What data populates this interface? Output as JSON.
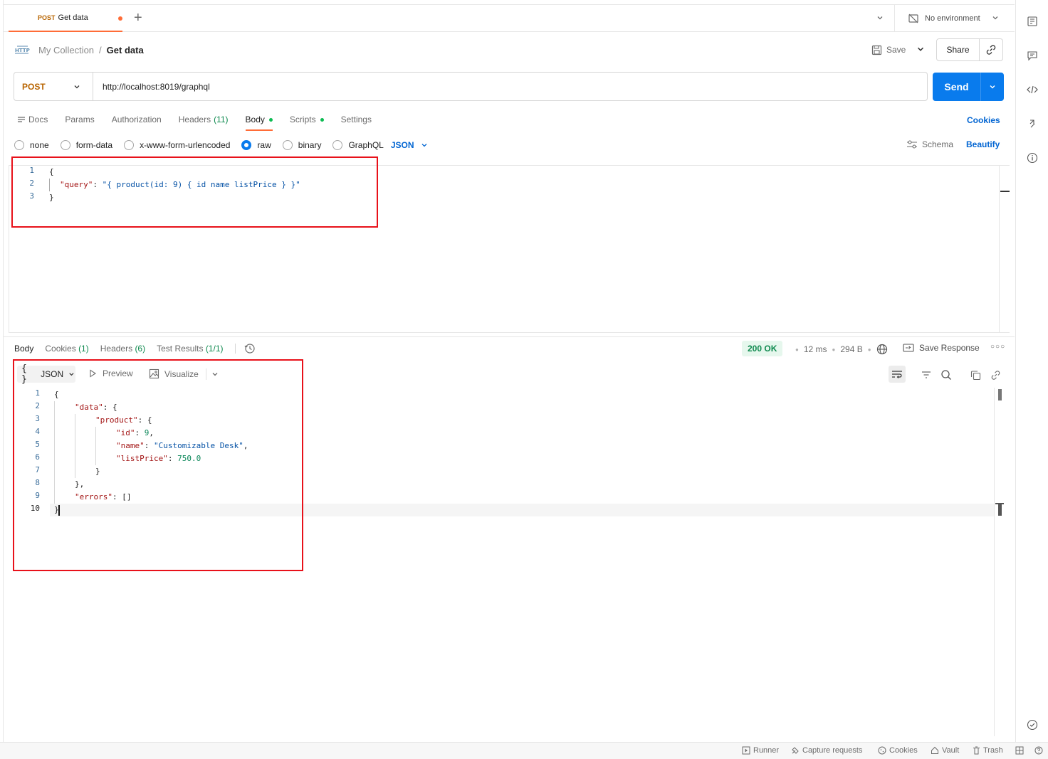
{
  "tabs": [
    {
      "method": "POST",
      "name": "Get data",
      "unsaved": true
    }
  ],
  "environment": {
    "label": "No environment"
  },
  "breadcrumb": {
    "collection": "My Collection",
    "separator": "/",
    "request": "Get data"
  },
  "header_actions": {
    "save": "Save",
    "share": "Share"
  },
  "request": {
    "method": "POST",
    "url": "http://localhost:8019/graphql",
    "send_label": "Send"
  },
  "request_tabs": {
    "docs": "Docs",
    "params": "Params",
    "authorization": "Authorization",
    "headers": "Headers",
    "headers_count": "(11)",
    "body": "Body",
    "scripts": "Scripts",
    "settings": "Settings",
    "cookies": "Cookies"
  },
  "body_types": {
    "none": "none",
    "form_data": "form-data",
    "urlencoded": "x-www-form-urlencoded",
    "raw": "raw",
    "binary": "binary",
    "graphql": "GraphQL",
    "format": "JSON",
    "schema": "Schema",
    "beautify": "Beautify"
  },
  "request_body": {
    "line_numbers": [
      "1",
      "2",
      "3"
    ],
    "open": "{",
    "key": "\"query\"",
    "colon": ": ",
    "value": "\"{ product(id: 9) { id name listPrice } }\"",
    "close": "}"
  },
  "response_tabs": {
    "body": "Body",
    "cookies": "Cookies",
    "cookies_count": "(1)",
    "headers": "Headers",
    "headers_count": "(6)",
    "tests": "Test Results",
    "tests_count": "(1/1)"
  },
  "response_meta": {
    "status": "200 OK",
    "time": "12 ms",
    "size": "294 B",
    "save_response": "Save Response"
  },
  "response_toolbar": {
    "format_braces": "{ }",
    "format": "JSON",
    "preview": "Preview",
    "visualize": "Visualize"
  },
  "response_body": {
    "line_numbers": [
      "1",
      "2",
      "3",
      "4",
      "5",
      "6",
      "7",
      "8",
      "9",
      "10"
    ],
    "l1": "{",
    "l2_key": "\"data\"",
    "l2_rest": ": {",
    "l3_key": "\"product\"",
    "l3_rest": ": {",
    "l4_key": "\"id\"",
    "l4_val": "9",
    "l5_key": "\"name\"",
    "l5_val": "\"Customizable Desk\"",
    "l6_key": "\"listPrice\"",
    "l6_val": "750.0",
    "l7": "}",
    "l8": "},",
    "l9_key": "\"errors\"",
    "l9_rest": ": []",
    "l10": "}"
  },
  "status_bar": {
    "runner": "Runner",
    "capture": "Capture requests",
    "cookies": "Cookies",
    "vault": "Vault",
    "trash": "Trash"
  },
  "colors": {
    "accent": "#ff6c37",
    "send": "#097bed",
    "link": "#0265d2",
    "success": "#0f8a4f",
    "highlight": "#e8111a"
  }
}
